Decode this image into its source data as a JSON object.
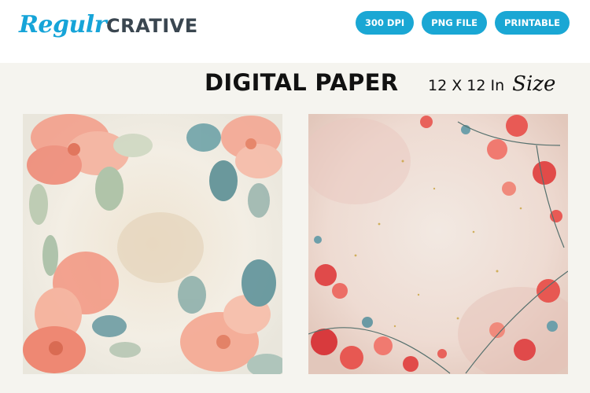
{
  "brand": {
    "script": "Regulr",
    "block": "CRATIVE"
  },
  "badges": [
    "300 DPI",
    "PNG FILE",
    "PRINTABLE"
  ],
  "heading": {
    "title": "DIGITAL PAPER",
    "size_text": "12 X 12 In",
    "size_script": "Size"
  },
  "previews": [
    {
      "name": "watercolor-floral-paper-1"
    },
    {
      "name": "watercolor-floral-paper-2"
    }
  ]
}
